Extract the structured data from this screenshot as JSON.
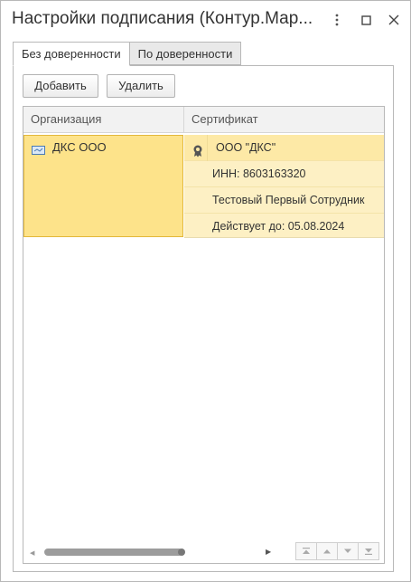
{
  "window": {
    "title": "Настройки подписания (Контур.Мар..."
  },
  "tabs": [
    {
      "label": "Без доверенности",
      "active": true
    },
    {
      "label": "По доверенности",
      "active": false
    }
  ],
  "toolbar": {
    "add_label": "Добавить",
    "delete_label": "Удалить"
  },
  "table": {
    "columns": [
      "Организация",
      "Сертификат"
    ],
    "rows": [
      {
        "organization": "ДКС ООО",
        "certificate": {
          "owner": "ООО \"ДКС\"",
          "inn": "ИНН: 8603163320",
          "employee": "Тестовый Первый Сотрудник",
          "valid_until": "Действует до: 05.08.2024"
        }
      }
    ]
  },
  "colors": {
    "selected_cell": "#fde38a",
    "selected_border": "#e3b83a",
    "row_highlight": "#fdf0c4"
  },
  "icons": {
    "more": "more-vertical-icon",
    "maximize": "maximize-icon",
    "close": "close-icon",
    "organization": "organization-icon",
    "certificate": "certificate-icon"
  }
}
